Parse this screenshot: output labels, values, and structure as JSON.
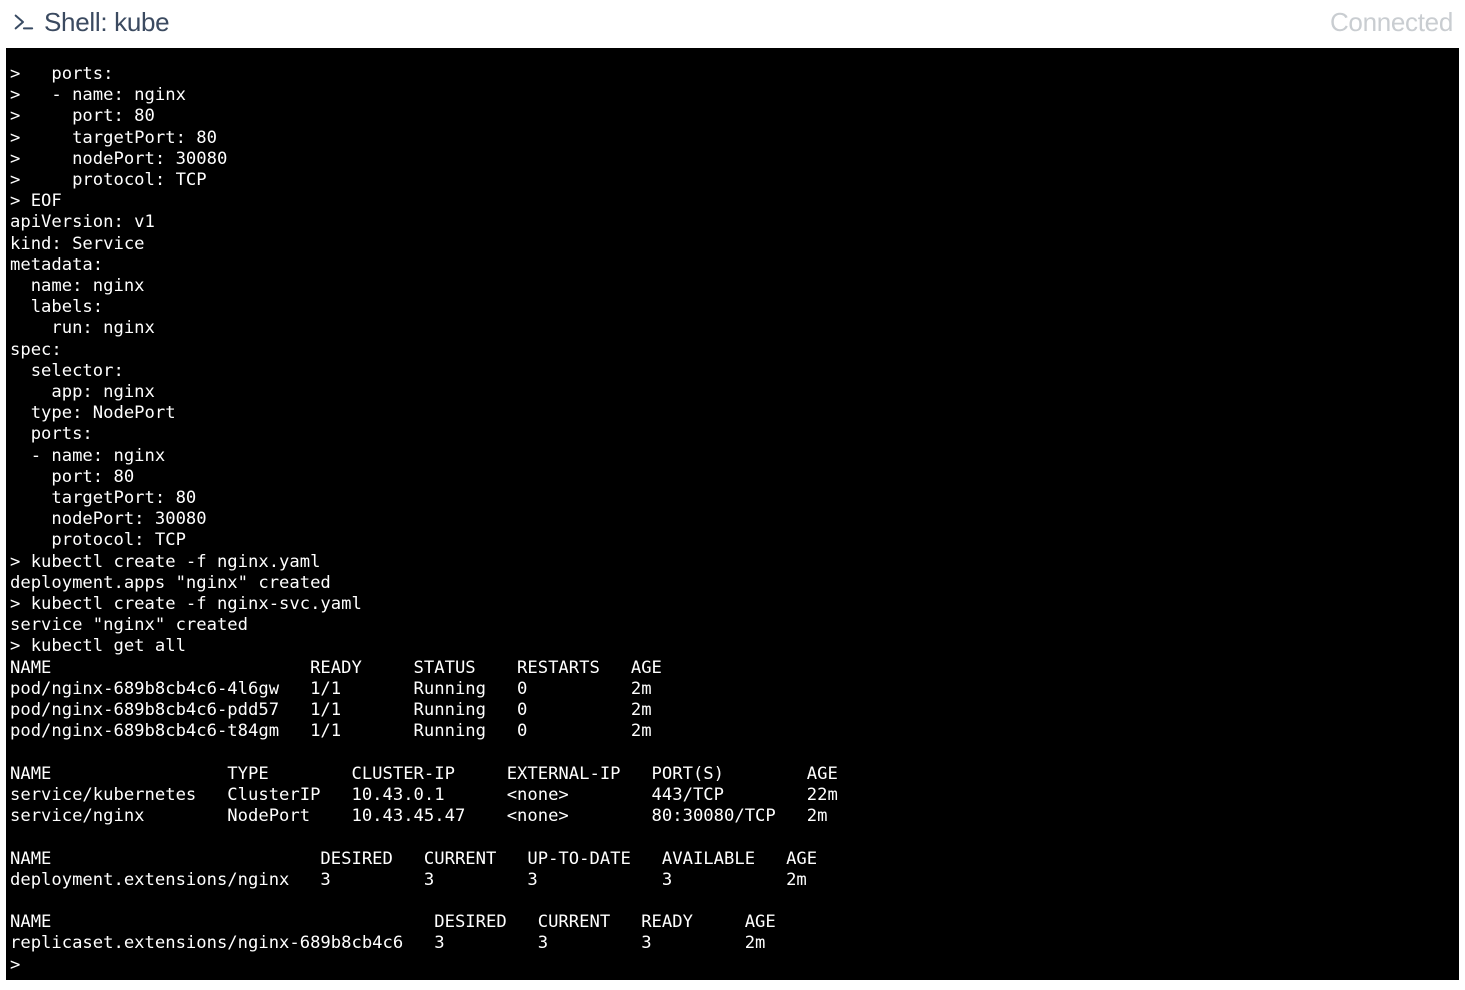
{
  "header": {
    "title": "Shell: kube",
    "status": "Connected"
  },
  "terminal": {
    "lines": [
      ">   ports:",
      ">   - name: nginx",
      ">     port: 80",
      ">     targetPort: 80",
      ">     nodePort: 30080",
      ">     protocol: TCP",
      "> EOF",
      "apiVersion: v1",
      "kind: Service",
      "metadata:",
      "  name: nginx",
      "  labels:",
      "    run: nginx",
      "spec:",
      "  selector:",
      "    app: nginx",
      "  type: NodePort",
      "  ports:",
      "  - name: nginx",
      "    port: 80",
      "    targetPort: 80",
      "    nodePort: 30080",
      "    protocol: TCP",
      "> kubectl create -f nginx.yaml",
      "deployment.apps \"nginx\" created",
      "> kubectl create -f nginx-svc.yaml",
      "service \"nginx\" created",
      "> kubectl get all",
      "NAME                         READY     STATUS    RESTARTS   AGE",
      "pod/nginx-689b8cb4c6-4l6gw   1/1       Running   0          2m",
      "pod/nginx-689b8cb4c6-pdd57   1/1       Running   0          2m",
      "pod/nginx-689b8cb4c6-t84gm   1/1       Running   0          2m",
      "",
      "NAME                 TYPE        CLUSTER-IP     EXTERNAL-IP   PORT(S)        AGE",
      "service/kubernetes   ClusterIP   10.43.0.1      <none>        443/TCP        22m",
      "service/nginx        NodePort    10.43.45.47    <none>        80:30080/TCP   2m",
      "",
      "NAME                          DESIRED   CURRENT   UP-TO-DATE   AVAILABLE   AGE",
      "deployment.extensions/nginx   3         3         3            3           2m",
      "",
      "NAME                                     DESIRED   CURRENT   READY     AGE",
      "replicaset.extensions/nginx-689b8cb4c6   3         3         3         2m",
      "> "
    ]
  }
}
